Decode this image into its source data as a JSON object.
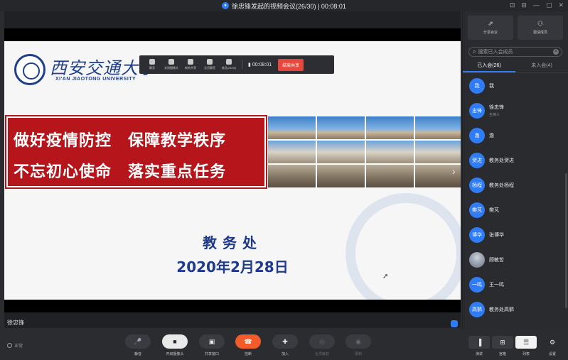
{
  "window": {
    "title": "徐忠锋发起的视频会议(26/30) | 00:08:01",
    "controls": [
      "⊡",
      "⊟",
      "—",
      "▢",
      "✕"
    ]
  },
  "stage": {
    "speaker_name": "徐忠锋",
    "slide": {
      "university_cn": "西安交通大学",
      "university_en": "XI'AN JIAOTONG UNIVERSITY",
      "banner_line1": "做好疫情防控　保障教学秩序",
      "banner_line2": "不忘初心使命　落实重点任务",
      "department": "教务处",
      "date": "2020年2月28日"
    },
    "share_toolbar": {
      "items": [
        "静音",
        "关闭摄像头",
        "新的共享",
        "全员静音",
        "成员(26/30)"
      ],
      "timer": "00:08:01",
      "end_label": "结束共享"
    }
  },
  "panel": {
    "actions": [
      {
        "icon": "share-icon",
        "label": "分享会议"
      },
      {
        "icon": "invite-icon",
        "label": "邀请成员"
      }
    ],
    "search_placeholder": "搜索已入会成员",
    "tabs": [
      {
        "label": "已入会(26)",
        "active": true
      },
      {
        "label": "未入会(4)",
        "active": false
      }
    ],
    "members": [
      {
        "avatar": "我",
        "name": "我",
        "role": "",
        "mic": false,
        "photo": false
      },
      {
        "avatar": "忠锋",
        "name": "徐忠锋",
        "role": "主持人",
        "mic": false,
        "photo": false
      },
      {
        "avatar": "澹",
        "name": "澹",
        "role": "",
        "mic": true,
        "photo": false
      },
      {
        "avatar": "贺进",
        "name": "教务处贺进",
        "role": "",
        "mic": true,
        "photo": false
      },
      {
        "avatar": "杨程",
        "name": "教务处杨程",
        "role": "",
        "mic": true,
        "photo": false
      },
      {
        "avatar": "樊芃",
        "name": "樊芃",
        "role": "",
        "mic": true,
        "photo": false
      },
      {
        "avatar": "博华",
        "name": "张博华",
        "role": "",
        "mic": true,
        "photo": false
      },
      {
        "avatar": "",
        "name": "顾敏哲",
        "role": "",
        "mic": true,
        "photo": true
      },
      {
        "avatar": "一鸣",
        "name": "王一鸣",
        "role": "",
        "mic": true,
        "photo": false
      },
      {
        "avatar": "高鹡",
        "name": "教务处高鹡",
        "role": "",
        "mic": true,
        "photo": false
      }
    ]
  },
  "bottombar": {
    "network": "正常",
    "buttons": [
      {
        "icon": "mic-icon",
        "label": "静音",
        "style": "normal"
      },
      {
        "icon": "camera-icon",
        "label": "开启摄像头",
        "style": "white"
      },
      {
        "icon": "share-screen-icon",
        "label": "共享窗口",
        "style": "normal"
      },
      {
        "icon": "hangup-icon",
        "label": "挂断",
        "style": "red"
      },
      {
        "icon": "add-user-icon",
        "label": "加入",
        "style": "normal"
      },
      {
        "icon": "mute-all-icon",
        "label": "全员静音",
        "style": "disabled"
      },
      {
        "icon": "record-icon",
        "label": "录制",
        "style": "disabled"
      }
    ],
    "right_buttons": [
      {
        "icon": "speaker-view-icon",
        "label": "演讲",
        "active": false
      },
      {
        "icon": "gallery-view-icon",
        "label": "宫格",
        "active": false
      },
      {
        "icon": "list-icon",
        "label": "列表",
        "active": true
      },
      {
        "icon": "settings-icon",
        "label": "设置",
        "active": false
      }
    ]
  }
}
